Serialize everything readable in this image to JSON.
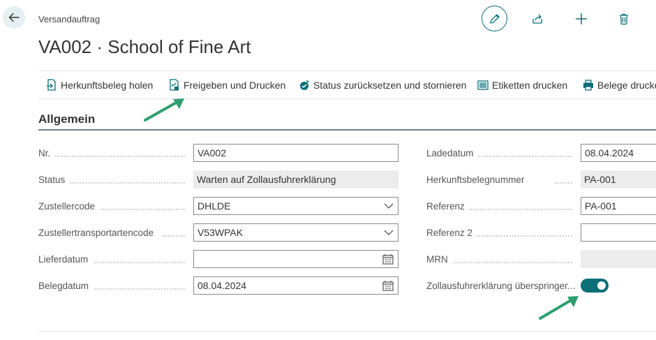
{
  "header": {
    "breadcrumb": "Versandauftrag",
    "title": "VA002 · School of Fine Art"
  },
  "actions": [
    {
      "label": "Herkunftsbeleg holen",
      "icon": "document-arrow-icon"
    },
    {
      "label": "Freigeben und Drucken",
      "icon": "document-release-icon"
    },
    {
      "label": "Status zurücksetzen und stornieren",
      "icon": "reset-status-icon"
    },
    {
      "label": "Etiketten drucken",
      "icon": "barcode-icon"
    },
    {
      "label": "Belege drucken",
      "icon": "printer-icon"
    }
  ],
  "section": {
    "title": "Allgemein"
  },
  "fields_left": [
    {
      "label": "Nr.",
      "value": "VA002",
      "kind": "text"
    },
    {
      "label": "Status",
      "value": "Warten auf Zollausfuhrerklärung",
      "kind": "readonly"
    },
    {
      "label": "Zustellercode",
      "value": "DHLDE",
      "kind": "select"
    },
    {
      "label": "Zustellertransportartencode",
      "value": "V53WPAK",
      "kind": "select"
    },
    {
      "label": "Lieferdatum",
      "value": "",
      "kind": "date"
    },
    {
      "label": "Belegdatum",
      "value": "08.04.2024",
      "kind": "date"
    }
  ],
  "fields_right": [
    {
      "label": "Ladedatum",
      "value": "08.04.2024",
      "kind": "text"
    },
    {
      "label": "Herkunftsbelegnummer",
      "value": "PA-001",
      "kind": "readonly"
    },
    {
      "label": "Referenz",
      "value": "PA-001",
      "kind": "text"
    },
    {
      "label": "Referenz 2",
      "value": "",
      "kind": "text"
    },
    {
      "label": "MRN",
      "value": "",
      "kind": "readonly"
    },
    {
      "label": "Zollausfuhrerklärung überspringen",
      "value": true,
      "kind": "toggle"
    }
  ],
  "colors": {
    "accent": "#0b6f78",
    "annotation_arrow": "#2e9e6e"
  }
}
